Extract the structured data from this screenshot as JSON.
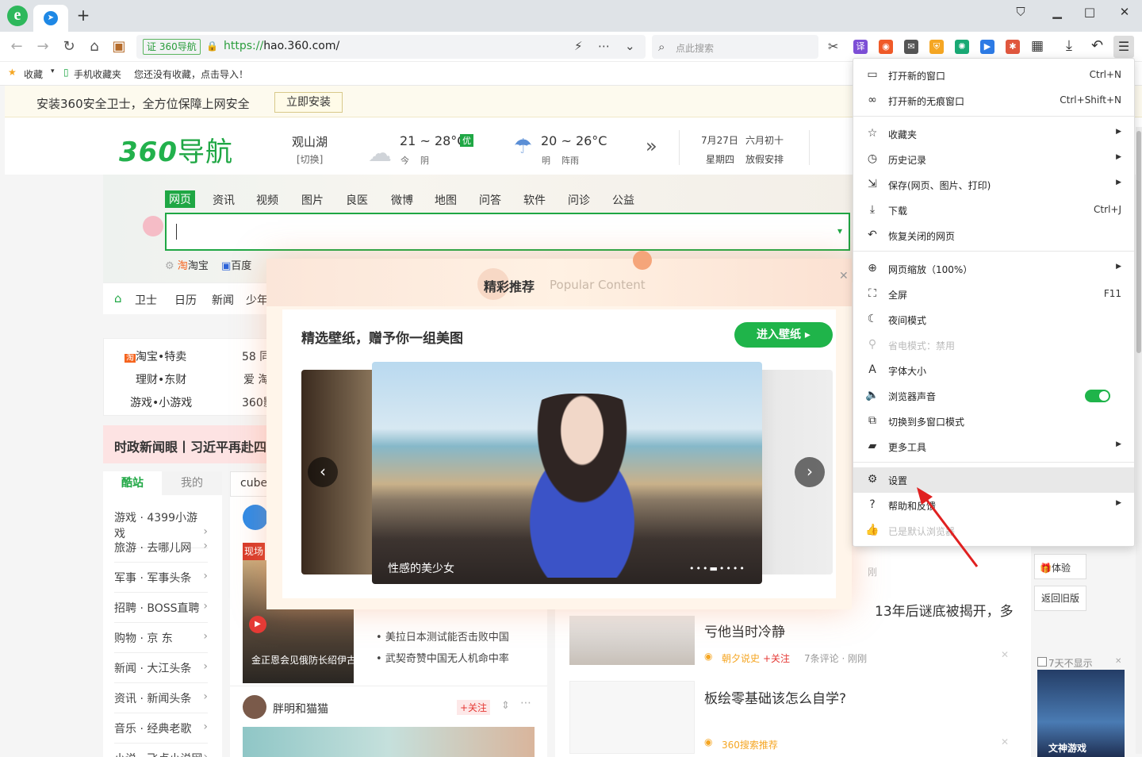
{
  "tabbar": {
    "logo": "e",
    "new_tab": "+",
    "min": "▁",
    "max": "□",
    "close": "✕",
    "shirt": "⛉"
  },
  "toolbar": {
    "badge": "证 360导航",
    "url_scheme": "https://",
    "url_rest": "hao.360.com/",
    "search_placeholder": "点此搜索",
    "ext_translate": "译"
  },
  "bookmarks": {
    "fav": "收藏",
    "mobile": "手机收藏夹",
    "hint": "您还没有收藏，点击导入！"
  },
  "install": {
    "text": "安装360安全卫士，全方位保障上网安全",
    "button": "立即安装"
  },
  "header": {
    "logo_num": "360",
    "logo_text": "导航",
    "city": "观山湖",
    "switch": "[切换]",
    "w1_temp": "21 ~ 28°C",
    "w1_q": "优",
    "w1_day": "今",
    "w1_cond": "阴",
    "w2_temp": "20 ~ 26°C",
    "w2_day": "明",
    "w2_cond": "阵雨",
    "more": "»",
    "date": "7月27日",
    "lunar": "六月初十",
    "weekday": "星期四",
    "holiday": "放假安排"
  },
  "search_tabs": [
    "资讯",
    "视频",
    "图片",
    "良医",
    "微博",
    "地图",
    "问答",
    "软件",
    "问诊",
    "公益"
  ],
  "search_tab_active": "网页",
  "hot": {
    "a": "淘宝",
    "b": "百度"
  },
  "navrow": {
    "a": "卫士",
    "b": "日历",
    "c": "新闻",
    "d": "少年"
  },
  "leftbox": {
    "r1": "淘宝•特卖",
    "r2": "理财•东财",
    "r3": "游戏•小游戏",
    "c1": "58 同",
    "c2": "爱 淘",
    "c3": "360影"
  },
  "news_strip": "时政新闻眼丨习近平再赴四",
  "side_tabs": {
    "active": "酷站",
    "other": "我的"
  },
  "side_items": [
    "游戏 · 4399小游戏",
    "旅游 · 去哪儿网",
    "军事 · 军事头条",
    "招聘 · BOSS直聘",
    "购物 · 京 东",
    "新闻 · 大江头条",
    "资讯 · 新闻头条",
    "音乐 · 经典老歌",
    "小说 · 飞卢小说网"
  ],
  "feed": {
    "tab": "cube",
    "scene": "现场",
    "video_caption": "金正恩会见俄防长绍伊古",
    "bullet1": "美拉日本测试能否击败中国",
    "bullet2": "武契奇赞中国无人机命中率",
    "author": "胖明和猫猫",
    "follow": "+关注"
  },
  "rightfeed": {
    "headline1": "13年后谜底被揭开，多",
    "headline1b": "亏他当时冷静",
    "source1": "朝夕说史",
    "follow": "+关注",
    "meta1": "7条评论 · 刚刚",
    "meta0": "刚",
    "headline2": "板绘零基础该怎么自学?",
    "source2": "360搜索推荐"
  },
  "rightside": {
    "try": "体验",
    "old": "返回旧版",
    "hide7": "7天不显示",
    "game": "文神游戏"
  },
  "modal": {
    "title": "精彩推荐",
    "subtitle": "Popular Content",
    "close": "✕",
    "card_title": "精选壁纸，赠予你一组美图",
    "card_button": "进入壁纸 ▸",
    "caption": "性感的美少女",
    "dots": "•••▬••••"
  },
  "menu": {
    "items": [
      {
        "label": "打开新的窗口",
        "shortcut": "Ctrl+N",
        "icon": "▭"
      },
      {
        "label": "打开新的无痕窗口",
        "shortcut": "Ctrl+Shift+N",
        "icon": "∞"
      },
      {
        "label": "收藏夹",
        "icon": "☆"
      },
      {
        "label": "历史记录",
        "icon": "◷"
      },
      {
        "label": "保存(网页、图片、打印)",
        "icon": "⇲"
      },
      {
        "label": "下载",
        "shortcut": "Ctrl+J",
        "icon": "⤓"
      },
      {
        "label": "恢复关闭的网页",
        "icon": "↶"
      },
      {
        "label": "网页缩放（100%）",
        "icon": "⊕"
      },
      {
        "label": "全屏",
        "shortcut": "F11",
        "icon": "⛶"
      },
      {
        "label": "夜间模式",
        "icon": "☾"
      },
      {
        "label": "省电模式：禁用",
        "icon": "⚲"
      },
      {
        "label": "字体大小",
        "icon": "A"
      },
      {
        "label": "浏览器声音",
        "icon": "🔈"
      },
      {
        "label": "切换到多窗口模式",
        "icon": "⧉"
      },
      {
        "label": "更多工具",
        "icon": "▰"
      },
      {
        "label": "设置",
        "icon": "⚙"
      },
      {
        "label": "帮助和反馈",
        "icon": "?"
      },
      {
        "label": "已是默认浏览器",
        "icon": "👍"
      }
    ]
  },
  "colors": {
    "brand": "#1fa744",
    "accent_toggle": "#1fb44a",
    "menu_highlight": "#e8e8e8"
  }
}
